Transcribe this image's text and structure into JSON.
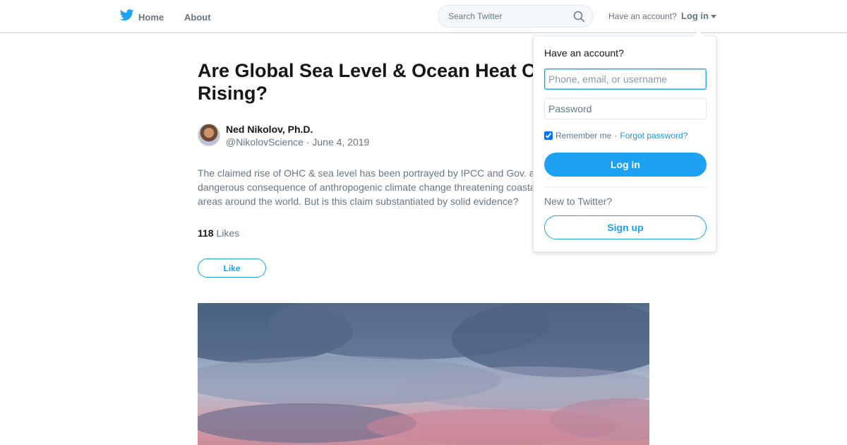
{
  "nav": {
    "home_label": "Home",
    "about_label": "About",
    "search_placeholder": "Search Twitter",
    "have_account": "Have an account?",
    "login_label": "Log in"
  },
  "article": {
    "title": "Are Global Sea Level & Ocean Heat Content Rising?",
    "author_name": "Ned Nikolov, Ph.D.",
    "author_handle": "@NikolovScience",
    "separator": "·",
    "date": "June 4, 2019",
    "body": "The claimed rise of OHC & sea level has been portrayed by IPCC and Gov. as a dangerous consequence of anthropogenic climate change threatening coastal areas around the world. But is this claim substantiated by solid evidence?",
    "likes_count": "118",
    "likes_label": "Likes",
    "like_button": "Like"
  },
  "login_dropdown": {
    "heading": "Have an account?",
    "username_placeholder": "Phone, email, or username",
    "password_placeholder": "Password",
    "remember_label": "Remember me",
    "separator": "·",
    "forgot_label": "Forgot password?",
    "login_button": "Log in",
    "new_label": "New to Twitter?",
    "signup_button": "Sign up"
  },
  "colors": {
    "brand": "#1da1f2",
    "muted_text": "#657786"
  }
}
